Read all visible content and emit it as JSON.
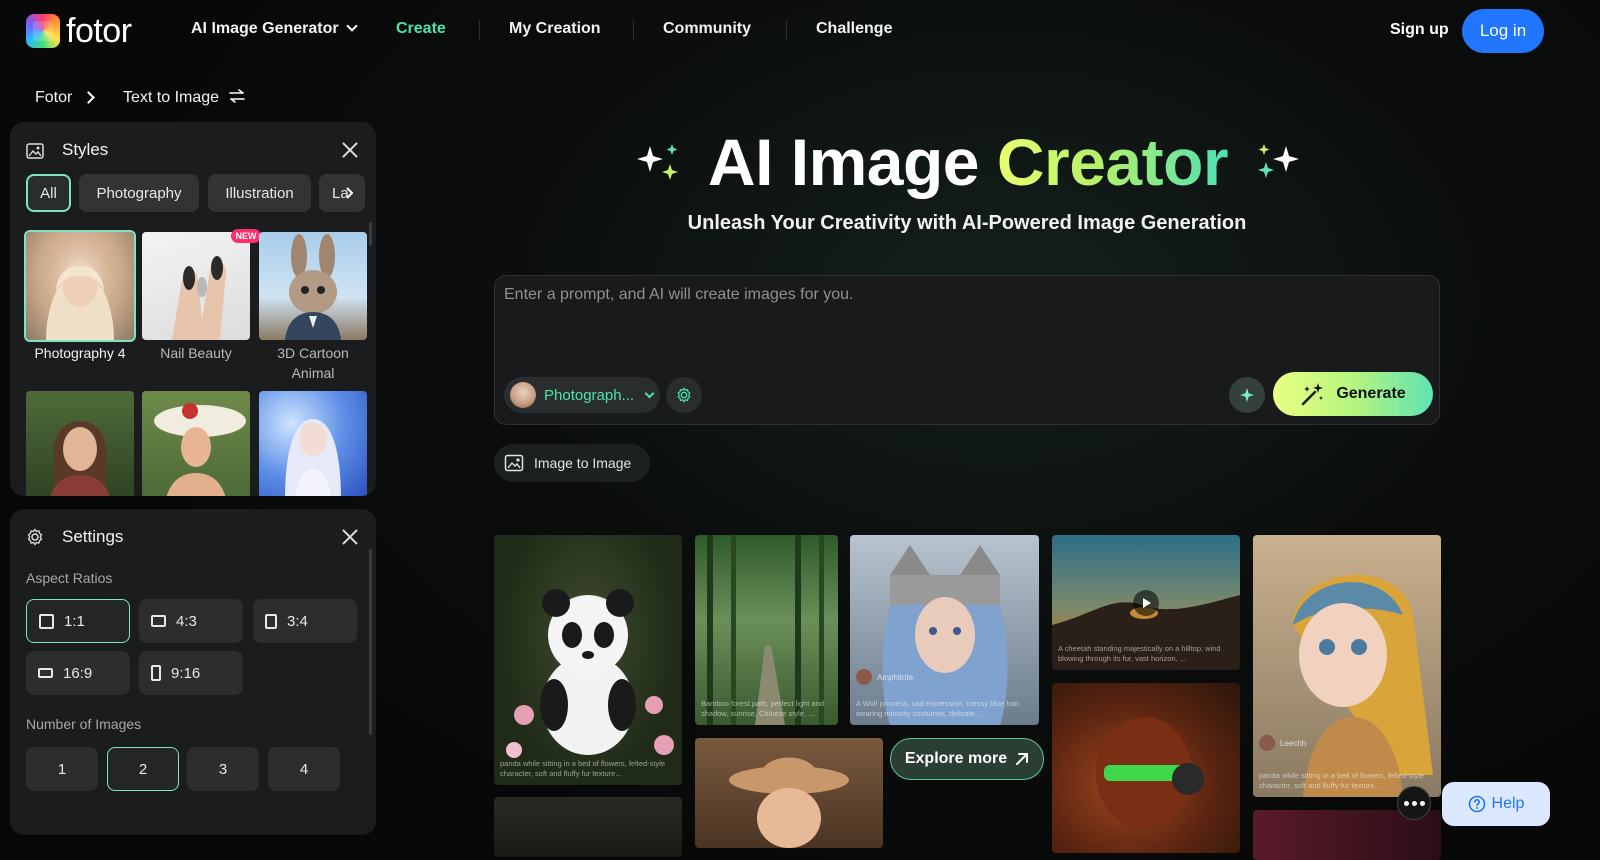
{
  "nav": {
    "logo": "fotor",
    "items": [
      {
        "label": "AI Image Generator"
      },
      {
        "label": "Create"
      },
      {
        "label": "My Creation"
      },
      {
        "label": "Community"
      },
      {
        "label": "Challenge"
      }
    ],
    "signup": "Sign up",
    "login": "Log in"
  },
  "breadcrumb": {
    "root": "Fotor",
    "current": "Text to Image"
  },
  "styles_panel": {
    "title": "Styles",
    "chips": [
      "All",
      "Photography",
      "Illustration",
      "La"
    ],
    "thumbs": [
      {
        "label": "Photography 4"
      },
      {
        "label": "Nail Beauty",
        "badge": "NEW"
      },
      {
        "label": "3D Cartoon Animal"
      }
    ]
  },
  "settings_panel": {
    "title": "Settings",
    "aspect_label": "Aspect Ratios",
    "ratios": [
      "1:1",
      "4:3",
      "3:4",
      "16:9",
      "9:16"
    ],
    "number_label": "Number of Images",
    "numbers": [
      "1",
      "2",
      "3",
      "4"
    ]
  },
  "hero": {
    "title_white": "AI Image",
    "title_gradient": "Creator",
    "subtitle": "Unleash Your Creativity with AI-Powered Image Generation"
  },
  "prompt": {
    "placeholder": "Enter a prompt, and AI will create images for you.",
    "style_selected": "Photograph...",
    "generate": "Generate"
  },
  "image_to_image": "Image to Image",
  "gallery": {
    "captions": {
      "panda": "panda while sitting in a bed of flowers, felted-style character, soft and fluffy fur texture...",
      "bamboo": "Bamboo forest path, perfect light and shadow, sunrise, Chinese style, ...",
      "wolf": "A Wolf princess, sad expression, messy blue hair, wearing minority costumes, delicate...",
      "cheetah": "A cheetah standing majestically on a hilltop, wind blowing through its fur, vast horizon, ...",
      "girl": "panda while sitting in a bed of flowers, felted-style character, soft and fluffy fur texture..."
    },
    "authors": {
      "wolf": "Amphitrite",
      "girl": "Leechh"
    }
  },
  "explore": "Explore more",
  "help": "Help",
  "colors": {
    "accent": "#4de3a5",
    "login_blue": "#2176ff",
    "panel": "#1b1c1d"
  }
}
